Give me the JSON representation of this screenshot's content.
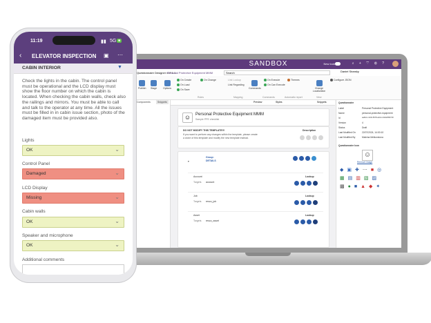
{
  "laptop": {
    "banner": "SANDBOX",
    "new_look": "New look",
    "user": "Daniel Sirarsky",
    "tabs": {
      "designer": "Questionnaire Designer v17.1.1",
      "ppe": "Personal Protective Equipment MMM",
      "search": "Search"
    },
    "ribbon": {
      "publish": "Publish",
      "stage": "Stage",
      "options": "Options",
      "on_create": "On Create",
      "on_load": "On Load",
      "on_save": "On Save",
      "on_change": "On Change",
      "link_lookup": "Link Lookup",
      "link_regarding": "Link Regarding",
      "commands": "Commands",
      "on_execute": "On Execute",
      "on_can_execute": "On Can Execute",
      "themes": "Themes",
      "change_localization": "Change Localization",
      "configure_json": "Configure JSON",
      "group_rules": "Rules",
      "group_mapping": "Mapping",
      "group_commands": "Commands",
      "group_automatic": "Automatic report",
      "group_view": "View"
    },
    "panes": {
      "components": "Components",
      "snippets": "Snippets",
      "preview": "Preview",
      "styles": "Styles",
      "snippets_right": "Snippets"
    },
    "template": {
      "title": "Personal Protective Equipment MMM",
      "subtitle": "Sample PPE checklist",
      "warning": "DO NOT MODIFY THIS TEMPLATE!!!",
      "warning_text": "If you want to perform any changes within the template, please create a clone of this template and modify the new template instead.",
      "description": "Description",
      "group_label": "Group:",
      "group_name": "DETAILS",
      "rows": [
        {
          "name": "Account",
          "targets": "Targets",
          "field": "account",
          "kind": "Lookup"
        },
        {
          "name": "Job",
          "targets": "Targets",
          "field": "resco_job",
          "kind": "Lookup"
        },
        {
          "name": "Asset",
          "targets": "Targets",
          "field": "resco_asset",
          "kind": "Lookup"
        }
      ]
    },
    "props": {
      "header": "Questionnaire",
      "rows": [
        {
          "k": "Label",
          "v": "Personal Protective Equipment"
        },
        {
          "k": "Name",
          "v": "personal-protective-equipment"
        },
        {
          "k": "Id",
          "v": "aabbcc-1234-5678-a1b2-c3d4e5f60718"
        },
        {
          "k": "Version",
          "v": "4"
        },
        {
          "k": "Status",
          "v": "Draft"
        },
        {
          "k": "Last Modified On",
          "v": "22/07/2024, 14:00:10"
        },
        {
          "k": "Last Modified By",
          "v": "Malvina Melkonstova"
        }
      ],
      "icon_header": "Questionnaire Icon",
      "remove_image": "Remove image"
    }
  },
  "phone": {
    "time": "11:19",
    "signal": "5G",
    "title": "ELEVATOR INSPECTION",
    "section": "CABIN INTERIOR",
    "instructions": "Check the lights in the cabin. The control panel must be operational and the LCD display must show the floor number on which the cabin is located. When checking the cabin walls, check also the railings and mirrors. You must be able to call and talk to the operator at any time. All the issues must be filled in in cabin issue section, photo of the damaged item must be provided also.",
    "fields": [
      {
        "label": "Lights",
        "value": "OK",
        "state": "ok"
      },
      {
        "label": "Control Panel",
        "value": "Damaged",
        "state": "bad"
      },
      {
        "label": "LCD Display",
        "value": "Missing",
        "state": "bad"
      },
      {
        "label": "Cabin walls",
        "value": "OK",
        "state": "ok"
      },
      {
        "label": "Speaker and microphone",
        "value": "OK",
        "state": "ok"
      }
    ],
    "additional": "Additional comments"
  },
  "colors": {
    "purple": "#5c3f7d",
    "ok_green": "#eef3c3",
    "bad_red": "#ef8f82",
    "accent_blue": "#2b5ba8"
  }
}
